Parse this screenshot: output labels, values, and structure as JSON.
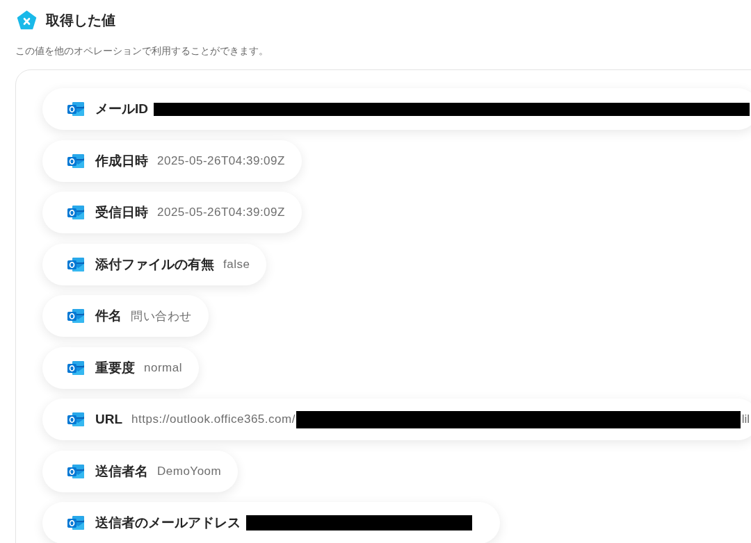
{
  "header": {
    "title": "取得した値",
    "description": "この値を他のオペレーションで利用することができます。"
  },
  "values": [
    {
      "label": "メールID",
      "redacted": true
    },
    {
      "label": "作成日時",
      "value": "2025-05-26T04:39:09Z",
      "redacted": false
    },
    {
      "label": "受信日時",
      "value": "2025-05-26T04:39:09Z",
      "redacted": false
    },
    {
      "label": "添付ファイルの有無",
      "value": "false",
      "redacted": false
    },
    {
      "label": "件名",
      "value": "問い合わせ",
      "redacted": false
    },
    {
      "label": "重要度",
      "value": "normal",
      "redacted": false
    },
    {
      "label": "URL",
      "value": "https://outlook.office365.com/",
      "redacted": true,
      "value_end": "lil"
    },
    {
      "label": "送信者名",
      "value": "DemoYoom",
      "redacted": false
    },
    {
      "label": "送信者のメールアドレス",
      "redacted": true
    }
  ]
}
